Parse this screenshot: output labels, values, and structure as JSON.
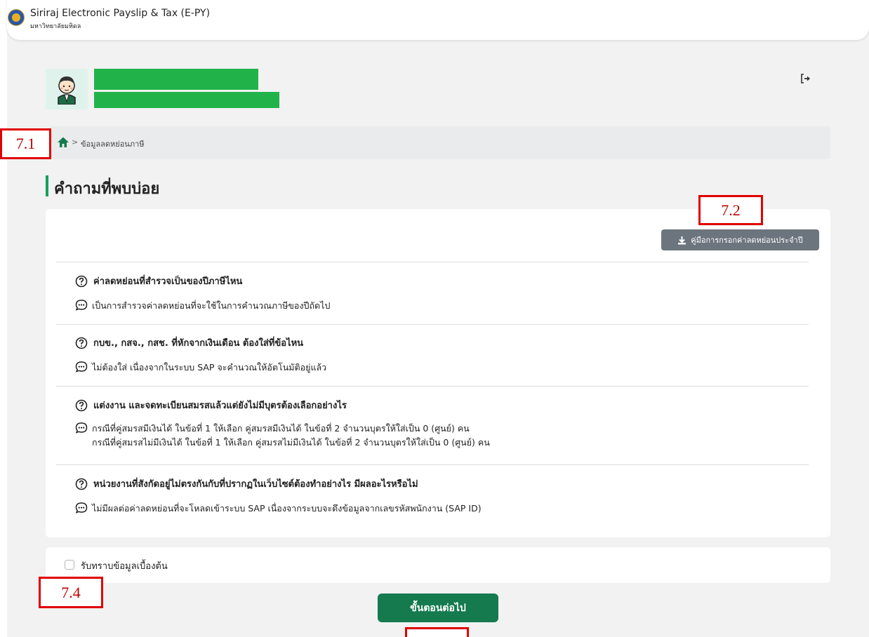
{
  "header": {
    "title": "Siriraj Electronic Payslip & Tax (E-PY)",
    "subtitle": "มหาวิทยาลัยมหิดล"
  },
  "breadcrumb": {
    "separator": ">",
    "current": "ข้อมูลลดหย่อนภาษี"
  },
  "page": {
    "heading": "คำถามที่พบบ่อย"
  },
  "faq": {
    "manual_button": "คู่มือการกรอกค่าลดหย่อนประจำปี",
    "items": [
      {
        "question": "ค่าลดหย่อนที่สำรวจเป็นของปีภาษีไหน",
        "answer_lines": [
          "เป็นการสำรวจค่าลดหย่อนที่จะใช้ในการคำนวณภาษีของปีถัดไป"
        ]
      },
      {
        "question": "กบข., กสจ., กสช. ที่หักจากเงินเดือน ต้องใส่ที่ข้อไหน",
        "answer_lines": [
          "ไม่ต้องใส่ เนื่องจากในระบบ SAP จะคำนวณให้อัตโนมัติอยู่แล้ว"
        ]
      },
      {
        "question": "แต่งงาน และจดทะเบียนสมรสแล้วแต่ยังไม่มีบุตรต้องเลือกอย่างไร",
        "answer_lines": [
          "กรณีที่คู่สมรสมีเงินได้ ในข้อที่ 1 ให้เลือก คู่สมรสมีเงินได้ ในข้อที่ 2 จำนวนบุตรให้ใส่เป็น 0 (ศูนย์) คน",
          "กรณีที่คู่สมรสไม่มีเงินได้ ในข้อที่ 1 ให้เลือก คู่สมรสไม่มีเงินได้ ในข้อที่ 2 จำนวนบุตรให้ใส่เป็น 0 (ศูนย์) คน"
        ]
      },
      {
        "question": "หน่วยงานที่สังกัดอยู่ไม่ตรงกันกับที่ปรากฏในเว็บไซต์ต้องทำอย่างไร มีผลอะไรหรือไม่",
        "answer_lines": [
          "ไม่มีผลต่อค่าลดหย่อนที่จะโหลดเข้าระบบ SAP เนื่องจากระบบจะดึงข้อมูลจากเลขรหัสพนักงาน (SAP ID)"
        ]
      }
    ]
  },
  "acknowledge": {
    "label": "รับทราบข้อมูลเบื้องต้น",
    "checked": false
  },
  "actions": {
    "next_label": "ขั้นตอนต่อไป"
  },
  "annotations": {
    "mark_71": "7.1",
    "mark_72": "7.2",
    "mark_74": "7.4",
    "mark_75": ""
  },
  "colors": {
    "primary": "#157a4e",
    "heading_accent": "#15a05a",
    "secondary_button": "#6c757d",
    "annotation": "#e00000"
  },
  "icons": {
    "home": "home-icon",
    "logout": "logout-icon",
    "download": "download-icon",
    "question": "question-circle-icon",
    "answer": "chat-dots-icon"
  }
}
